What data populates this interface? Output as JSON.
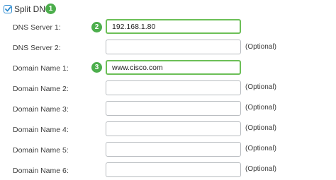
{
  "header": {
    "label": "Split DNS",
    "checked": true
  },
  "badges": [
    "1",
    "2",
    "3"
  ],
  "optional_text": "(Optional)",
  "rows": [
    {
      "label": "DNS Server 1:",
      "value": "192.168.1.80",
      "optional": false,
      "active": true
    },
    {
      "label": "DNS Server 2:",
      "value": "",
      "optional": true,
      "active": false
    },
    {
      "label": "Domain Name 1:",
      "value": "www.cisco.com",
      "optional": false,
      "active": true
    },
    {
      "label": "Domain Name 2:",
      "value": "",
      "optional": true,
      "active": false
    },
    {
      "label": "Domain Name 3:",
      "value": "",
      "optional": true,
      "active": false
    },
    {
      "label": "Domain Name 4:",
      "value": "",
      "optional": true,
      "active": false
    },
    {
      "label": "Domain Name 5:",
      "value": "",
      "optional": true,
      "active": false
    },
    {
      "label": "Domain Name 6:",
      "value": "",
      "optional": true,
      "active": false
    }
  ],
  "colors": {
    "badge": "#4cae4c",
    "active_border": "#6cbf57",
    "checkbox": "#2e8bd0"
  }
}
